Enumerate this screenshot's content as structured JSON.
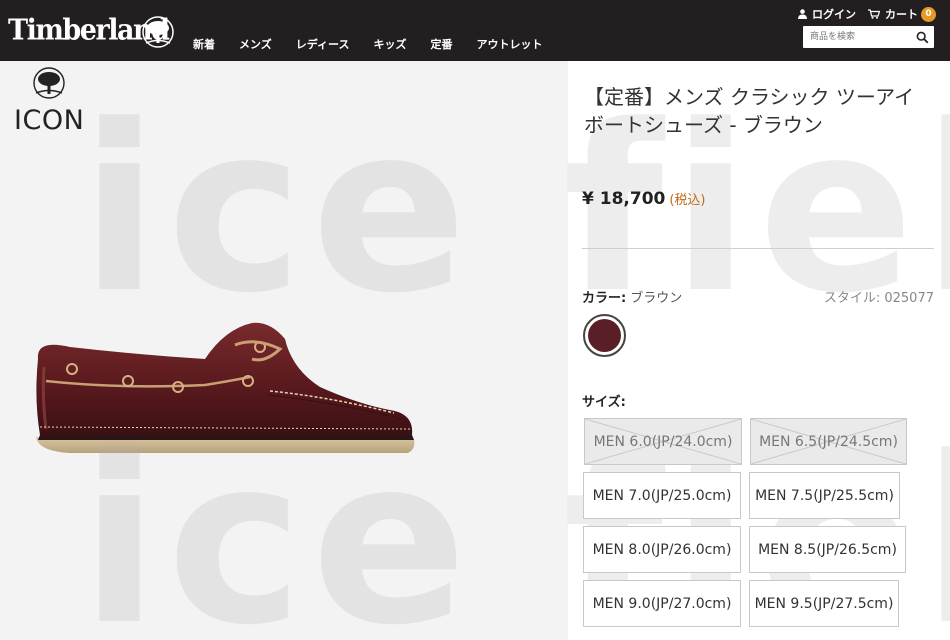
{
  "header": {
    "logo": "Timberland",
    "nav": [
      "新着",
      "メンズ",
      "レディース",
      "キッズ",
      "定番",
      "アウトレット"
    ],
    "login_label": "ログイン",
    "cart_label": "カート",
    "cart_count": "0",
    "search_placeholder": "商品を検索"
  },
  "badge": {
    "text": "ICON"
  },
  "watermark": {
    "line1": "ice field",
    "line2": "ice field"
  },
  "product": {
    "title": "【定番】メンズ クラシック ツーアイ ボートシューズ - ブラウン",
    "price": "¥ 18,700",
    "tax_note": "(税込)",
    "color_label": "カラー:",
    "color_value": "ブラウン",
    "style_code": "スタイル: 025077",
    "swatch_color": "#5a1f26",
    "size_label": "サイズ:",
    "sizes": [
      {
        "label": "MEN 6.0(JP/24.0cm)",
        "available": false
      },
      {
        "label": "MEN 6.5(JP/24.5cm)",
        "available": false
      },
      {
        "label": "MEN 7.0(JP/25.0cm)",
        "available": true
      },
      {
        "label": "MEN 7.5(JP/25.5cm)",
        "available": true
      },
      {
        "label": "MEN 8.0(JP/26.0cm)",
        "available": true
      },
      {
        "label": "MEN 8.5(JP/26.5cm)",
        "available": true
      },
      {
        "label": "MEN 9.0(JP/27.0cm)",
        "available": true
      },
      {
        "label": "MEN 9.5(JP/27.5cm)",
        "available": true
      }
    ]
  },
  "colors": {
    "header_bg": "#231f20",
    "accent": "#e69a26",
    "tax": "#c06a18"
  }
}
